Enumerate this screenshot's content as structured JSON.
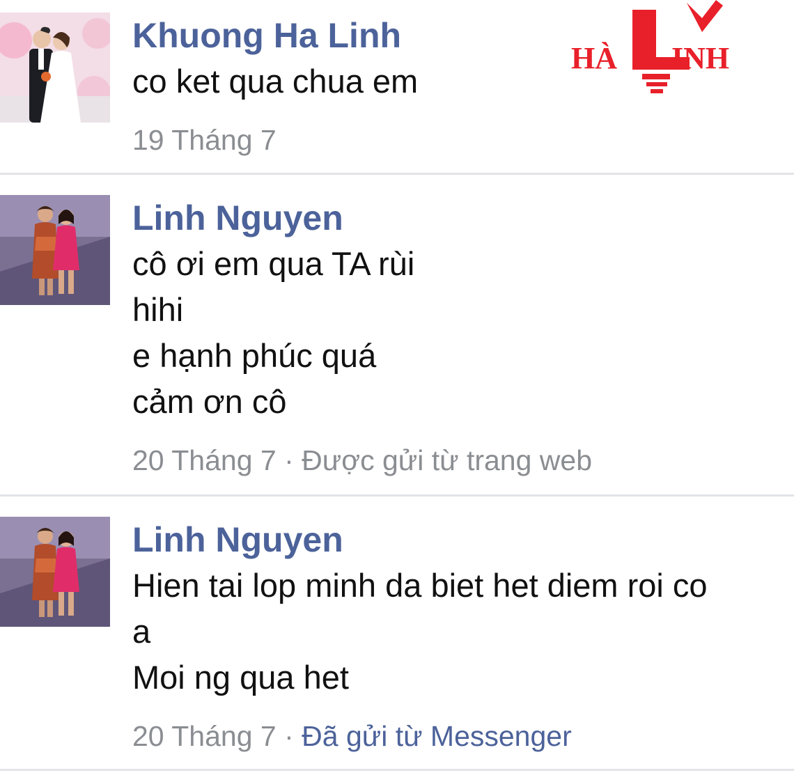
{
  "messages": [
    {
      "sender": "Khuong Ha Linh",
      "lines": [
        "co ket qua chua em"
      ],
      "date": "19 Tháng 7",
      "source": ""
    },
    {
      "sender": "Linh Nguyen",
      "lines": [
        "cô ơi em qua TA rùi",
        "hihi",
        "e hạnh phúc quá",
        "cảm ơn cô"
      ],
      "date": "20 Tháng 7",
      "source": "Được gửi từ trang web"
    },
    {
      "sender": "Linh Nguyen",
      "lines": [
        "Hien tai lop minh da biet het diem roi co",
        "a",
        "Moi ng qua het"
      ],
      "date": "20 Tháng 7",
      "source": "Đã gửi từ Messenger"
    }
  ],
  "meta_separator": " · ",
  "watermark": {
    "text": "HÀ LINH",
    "color": "#e8202a"
  },
  "colors": {
    "sender": "#4c629a",
    "meta": "#8a8d91",
    "divider": "#e3e4e8"
  }
}
